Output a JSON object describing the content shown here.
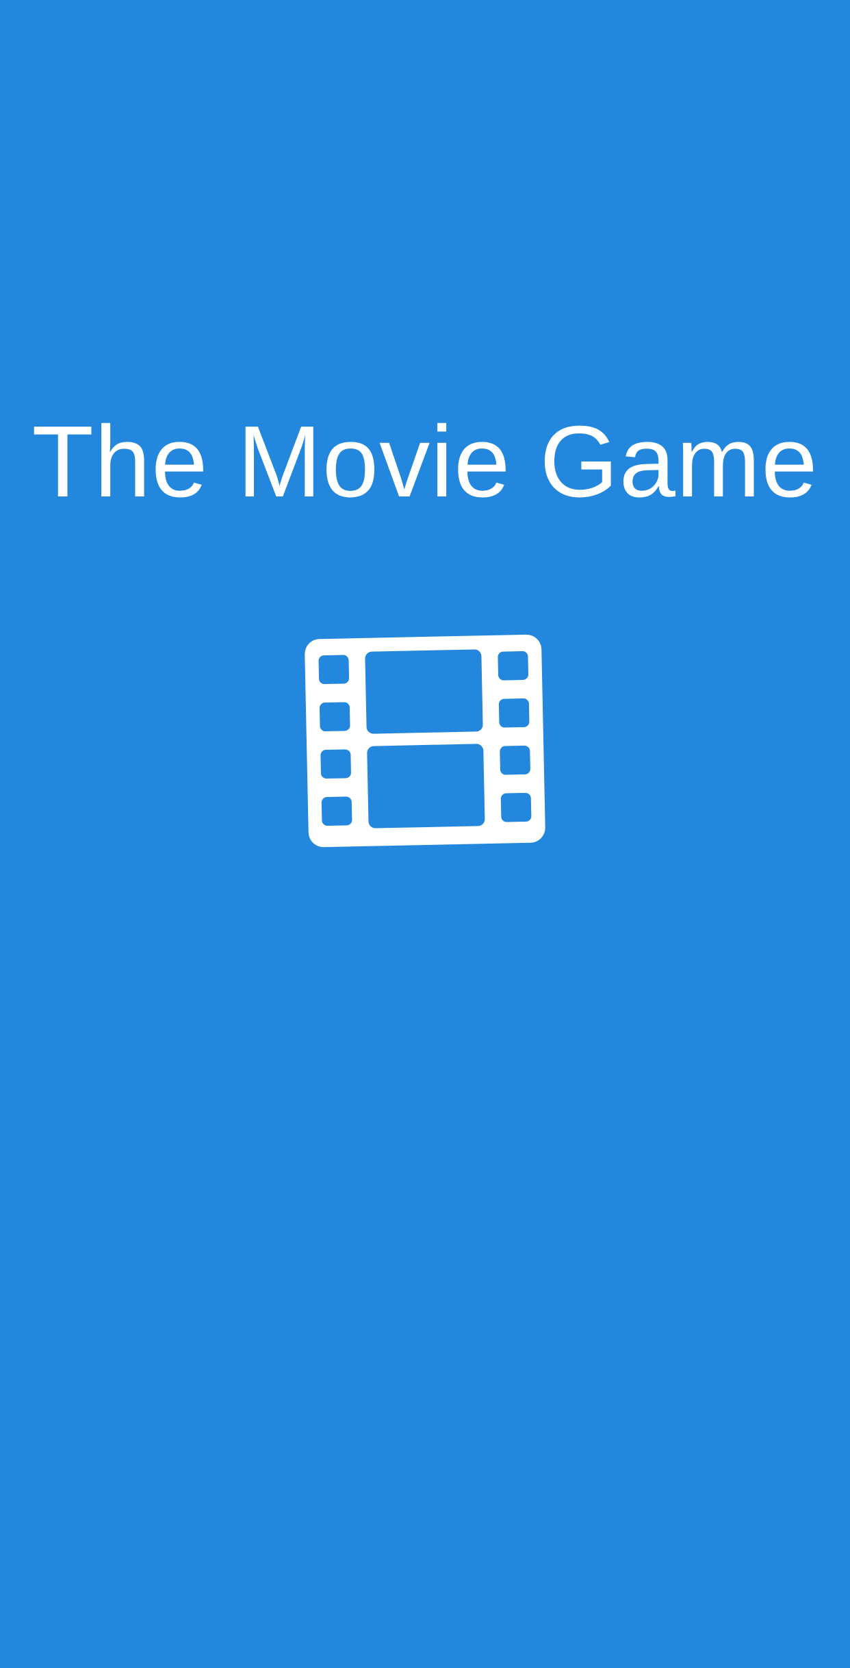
{
  "splash": {
    "title": "The Movie Game",
    "logo_icon": "film-strip-icon",
    "background_color": "#2388dd",
    "foreground_color": "#ffffff"
  }
}
